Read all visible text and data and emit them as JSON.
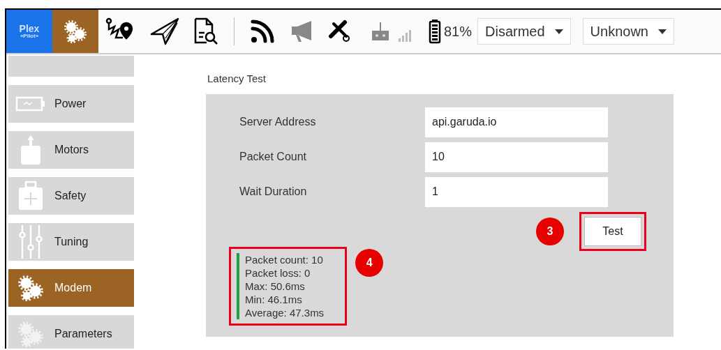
{
  "toolbar": {
    "logo": {
      "line1": "Plex",
      "line2": "«Pilot»"
    },
    "battery": "81%",
    "arm_state": "Disarmed",
    "flight_mode": "Unknown"
  },
  "sidebar": {
    "items": [
      {
        "label": "Power",
        "kind": "battery",
        "selected": false
      },
      {
        "label": "Motors",
        "kind": "motor",
        "selected": false
      },
      {
        "label": "Safety",
        "kind": "kit",
        "selected": false
      },
      {
        "label": "Tuning",
        "kind": "sliders",
        "selected": false
      },
      {
        "label": "Modem",
        "kind": "gears",
        "selected": true
      },
      {
        "label": "Parameters",
        "kind": "gears",
        "selected": false
      }
    ]
  },
  "section_title": "Latency Test",
  "form": {
    "fields": [
      {
        "label": "Server Address",
        "value": "api.garuda.io"
      },
      {
        "label": "Packet Count",
        "value": "10"
      },
      {
        "label": "Wait Duration",
        "value": "1"
      }
    ],
    "button": "Test"
  },
  "results": [
    "Packet count: 10",
    "Packet loss: 0",
    "Max: 50.6ms",
    "Min: 46.1ms",
    "Average: 47.3ms"
  ],
  "callouts": [
    "3",
    "4"
  ]
}
